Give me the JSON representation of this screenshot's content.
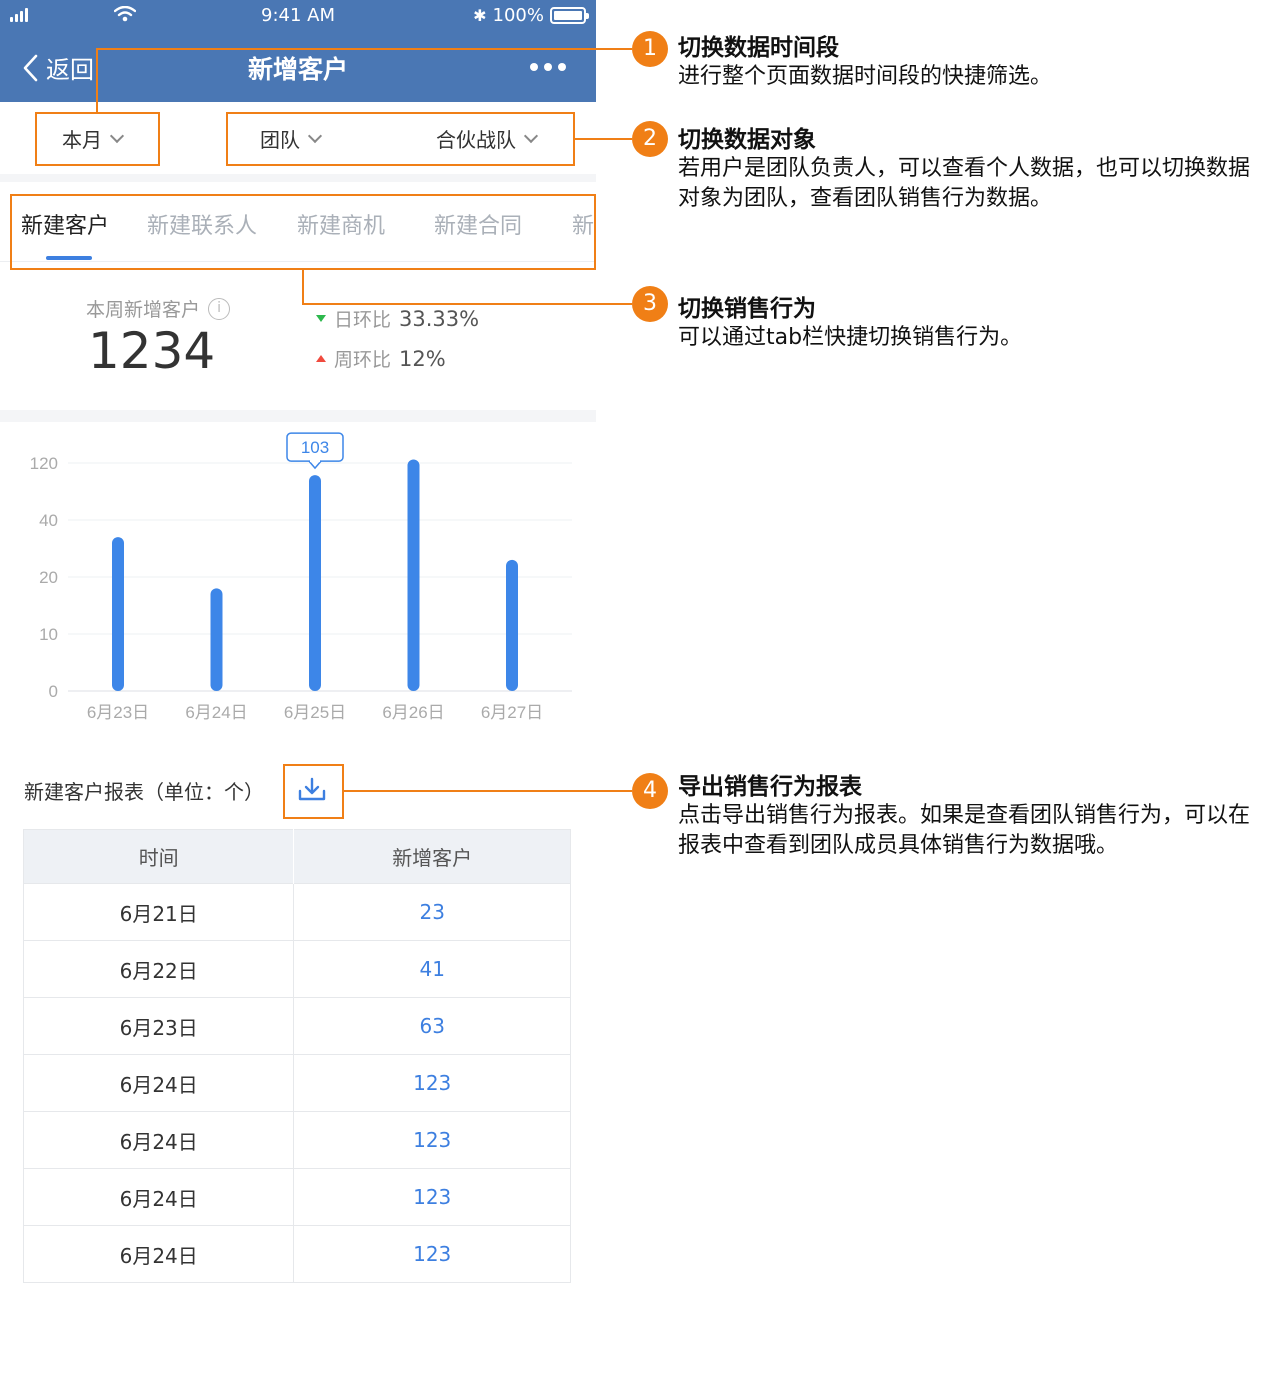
{
  "status_bar": {
    "time": "9:41 AM",
    "battery": "100%",
    "battery_level": 1.0
  },
  "nav": {
    "back_label": "返回",
    "title": "新增客户"
  },
  "filters": {
    "period": "本月",
    "scope": "团队",
    "team": "合伙战队"
  },
  "tabs": [
    {
      "label": "新建客户",
      "active": true
    },
    {
      "label": "新建联系人",
      "active": false
    },
    {
      "label": "新建商机",
      "active": false
    },
    {
      "label": "新建合同",
      "active": false
    },
    {
      "label": "新建",
      "active": false
    }
  ],
  "summary": {
    "label": "本周新增客户",
    "value": "1234",
    "day_compare_label": "日环比",
    "day_compare_value": "33.33%",
    "week_compare_label": "周环比",
    "week_compare_value": "12%"
  },
  "chart_data": {
    "type": "bar",
    "categories": [
      "6月23日",
      "6月24日",
      "6月25日",
      "6月26日",
      "6月27日"
    ],
    "values": [
      34,
      18,
      103,
      125,
      26
    ],
    "y_ticks": [
      "0",
      "10",
      "20",
      "40",
      "120"
    ],
    "highlight_label": "103",
    "highlight_index": 2,
    "bar_color": "#3d86e8",
    "grid": true
  },
  "report": {
    "title": "新建客户报表（单位：个）",
    "columns": [
      "时间",
      "新增客户"
    ],
    "rows": [
      [
        "6月21日",
        "23"
      ],
      [
        "6月22日",
        "41"
      ],
      [
        "6月23日",
        "63"
      ],
      [
        "6月24日",
        "123"
      ],
      [
        "6月24日",
        "123"
      ],
      [
        "6月24日",
        "123"
      ],
      [
        "6月24日",
        "123"
      ]
    ]
  },
  "annotations": [
    {
      "number": "1",
      "title": "切换数据时间段",
      "desc": "进行整个页面数据时间段的快捷筛选。"
    },
    {
      "number": "2",
      "title": "切换数据对象",
      "desc": "若用户是团队负责人，可以查看个人数据，也可以切换数据对象为团队，查看团队销售行为数据。"
    },
    {
      "number": "3",
      "title": "切换销售行为",
      "desc": "可以通过tab栏快捷切换销售行为。"
    },
    {
      "number": "4",
      "title": "导出销售行为报表",
      "desc": "点击导出销售行为报表。如果是查看团队销售行为，可以在报表中查看到团队成员具体销售行为数据哦。"
    }
  ],
  "colors": {
    "header_bg": "#4a77b4",
    "accent": "#3d7fe0",
    "annotation": "#f07f16",
    "up": "#f04a3e",
    "down": "#2db84d"
  }
}
